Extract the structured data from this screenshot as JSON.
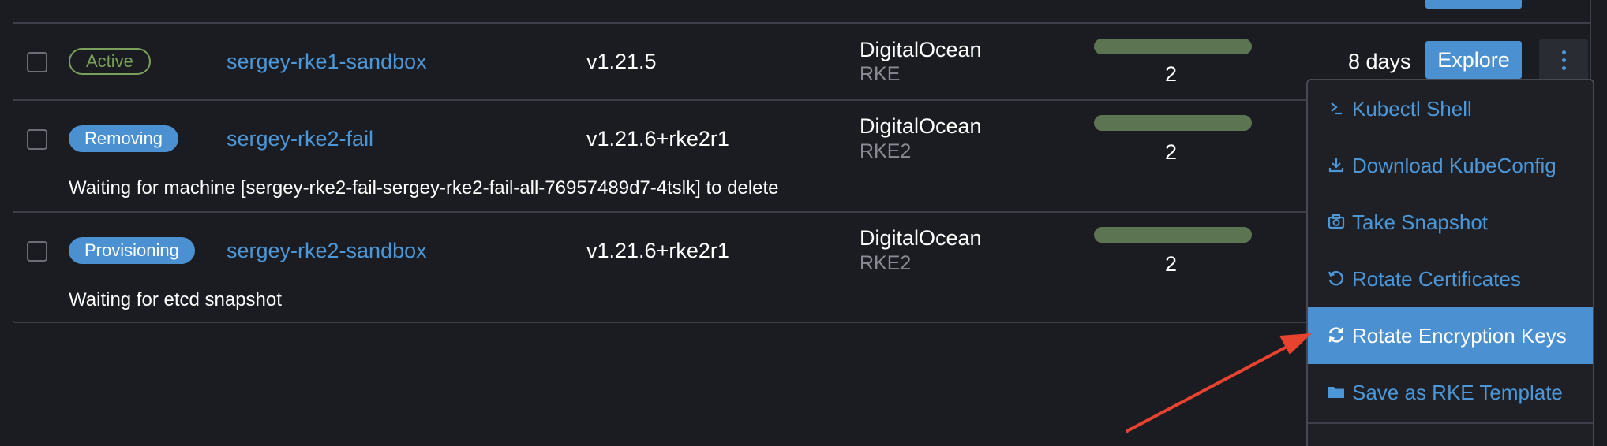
{
  "clusters": [
    {
      "state": "Active",
      "name": "sergey-rke1-sandbox",
      "version": "v1.21.5",
      "provider": "DigitalOcean",
      "distro": "RKE",
      "machines": "2",
      "age": "8 days",
      "explore_label": "Explore"
    },
    {
      "state": "Removing",
      "name": "sergey-rke2-fail",
      "version": "v1.21.6+rke2r1",
      "provider": "DigitalOcean",
      "distro": "RKE2",
      "machines": "2",
      "message": "Waiting for machine [sergey-rke2-fail-sergey-rke2-fail-all-76957489d7-4tslk] to delete"
    },
    {
      "state": "Provisioning",
      "name": "sergey-rke2-sandbox",
      "version": "v1.21.6+rke2r1",
      "provider": "DigitalOcean",
      "distro": "RKE2",
      "machines": "2",
      "message": "Waiting for etcd snapshot"
    }
  ],
  "action_menu": {
    "items": [
      {
        "label": "Kubectl Shell",
        "icon": "terminal-icon"
      },
      {
        "label": "Download KubeConfig",
        "icon": "download-icon"
      },
      {
        "label": "Take Snapshot",
        "icon": "camera-icon"
      },
      {
        "label": "Rotate Certificates",
        "icon": "rotate-icon"
      },
      {
        "label": "Rotate Encryption Keys",
        "icon": "refresh-icon",
        "highlighted": true
      },
      {
        "label": "Save as RKE Template",
        "icon": "folder-icon"
      }
    ]
  },
  "colors": {
    "background": "#1b1c21",
    "link": "#4b97d8",
    "primary_button": "#4b91d1",
    "active_badge": "#7aa05a",
    "progress_bar": "#5d7452",
    "annotation_arrow": "#e8432f"
  }
}
